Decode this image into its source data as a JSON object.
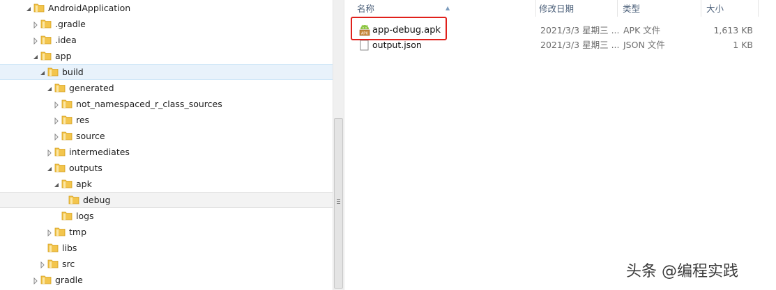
{
  "tree": {
    "items": [
      {
        "label": "AndroidApplication",
        "state": "expanded"
      },
      {
        "label": ".gradle",
        "state": "collapsed"
      },
      {
        "label": ".idea",
        "state": "collapsed"
      },
      {
        "label": "app",
        "state": "expanded"
      },
      {
        "label": "build",
        "state": "expanded"
      },
      {
        "label": "generated",
        "state": "expanded"
      },
      {
        "label": "not_namespaced_r_class_sources",
        "state": "collapsed"
      },
      {
        "label": "res",
        "state": "collapsed"
      },
      {
        "label": "source",
        "state": "collapsed"
      },
      {
        "label": "intermediates",
        "state": "collapsed"
      },
      {
        "label": "outputs",
        "state": "expanded"
      },
      {
        "label": "apk",
        "state": "expanded"
      },
      {
        "label": "debug",
        "state": "leaf"
      },
      {
        "label": "logs",
        "state": "leaf"
      },
      {
        "label": "tmp",
        "state": "collapsed"
      },
      {
        "label": "libs",
        "state": "leaf"
      },
      {
        "label": "src",
        "state": "collapsed"
      },
      {
        "label": "gradle",
        "state": "collapsed"
      }
    ]
  },
  "file_list": {
    "columns": {
      "name": "名称",
      "modified": "修改日期",
      "type": "类型",
      "size": "大小"
    },
    "files": [
      {
        "name": "app-debug.apk",
        "modified": "2021/3/3 星期三 ...",
        "type": "APK 文件",
        "size": "1,613 KB",
        "icon": "apk-icon"
      },
      {
        "name": "output.json",
        "modified": "2021/3/3 星期三 ...",
        "type": "JSON 文件",
        "size": "1 KB",
        "icon": "json-file-icon"
      }
    ]
  },
  "watermark": "头条 @编程实践",
  "colors": {
    "highlight_border": "#e0201b",
    "selected_row": "#e8f2fb",
    "header_text": "#4c607a",
    "folder": "#f3c54d"
  }
}
